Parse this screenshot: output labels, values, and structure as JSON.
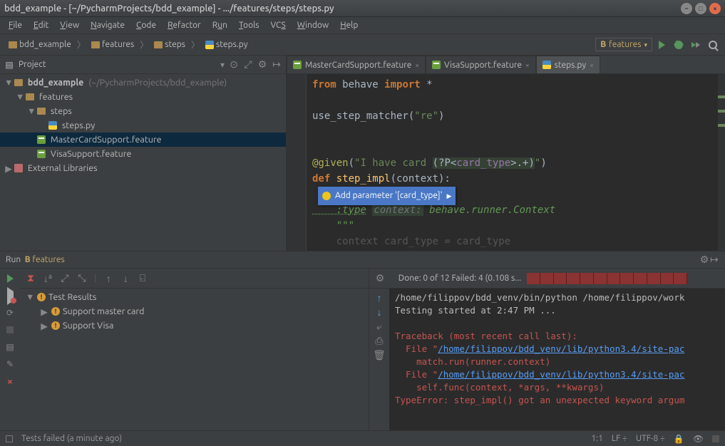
{
  "window": {
    "title": "bdd_example - [~/PycharmProjects/bdd_example] - .../features/steps/steps.py"
  },
  "menu": [
    "File",
    "Edit",
    "View",
    "Navigate",
    "Code",
    "Refactor",
    "Run",
    "Tools",
    "VCS",
    "Window",
    "Help"
  ],
  "breadcrumb": {
    "root": "bdd_example",
    "features": "features",
    "steps": "steps",
    "file": "steps.py"
  },
  "run_config": {
    "label": "features"
  },
  "project": {
    "panel_title": "Project",
    "root": "bdd_example",
    "root_path": "(~/PycharmProjects/bdd_example)",
    "features": "features",
    "steps_dir": "steps",
    "steps_file": "steps.py",
    "feat1": "MasterCardSupport.feature",
    "feat2": "VisaSupport.feature",
    "ext_libs": "External Libraries"
  },
  "tabs": {
    "t1": "MasterCardSupport.feature",
    "t2": "VisaSupport.feature",
    "t3": "steps.py"
  },
  "code": {
    "l1_from": "from",
    "l1_mod": " behave ",
    "l1_imp": "import",
    "l1_star": " *",
    "l3a": "use_step_matcher(",
    "l3b": "\"re\"",
    "l3c": ")",
    "l6a": "@given",
    "l6b": "(",
    "l6c": "\"I have card ",
    "l6d": "(?P<",
    "l6e": "card_type",
    "l6f": ">.+)",
    "l6g": "\"",
    "l6h": ")",
    "l7a": "def ",
    "l7b": "step_impl",
    "l7c": "(context):",
    "l9": "    :type context: behave.runner.Context",
    "l8": "    \"\"\"",
    "l10": "    \"\"\"",
    "l11": "    context.card_type = card_type"
  },
  "intention": {
    "label": "Add parameter '[card_type]'"
  },
  "run": {
    "header": "Run",
    "cfg": "features",
    "done": "Done: 0 of 12  Failed: 4  (0.108 s...",
    "test_results": "Test Results",
    "t1": "Support master card",
    "t2": "Support Visa"
  },
  "console": {
    "l1": "/home/filippov/bdd_venv/bin/python /home/filippov/work",
    "l2": "Testing started at 2:47 PM ...",
    "l4": "Traceback (most recent call last):",
    "l5a": "  File \"",
    "l5b": "/home/filippov/bdd_venv/lib/python3.4/site-pac",
    "l6": "    match.run(runner.context)",
    "l7a": "  File \"",
    "l7b": "/home/filippov/bdd_venv/lib/python3.4/site-pac",
    "l8": "    self.func(context, *args, **kwargs)",
    "l9": "TypeError: step_impl() got an unexpected keyword argum"
  },
  "status": {
    "msg": "Tests failed (a minute ago)",
    "pos": "1:1",
    "sep1": "LF",
    "sep2": "UTF-8"
  }
}
